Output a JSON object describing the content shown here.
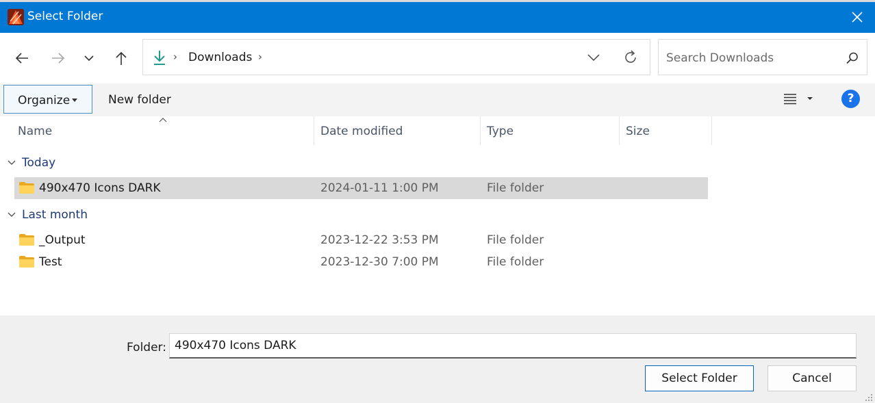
{
  "window": {
    "title": "Select Folder",
    "title_bar_color": "#0078d4",
    "app_icon": "affinity-publisher-icon",
    "close_icon": "close-icon"
  },
  "nav": {
    "back_icon": "arrow-left-icon",
    "forward_icon": "arrow-right-icon",
    "recent_icon": "chevron-down-icon",
    "up_icon": "arrow-up-icon"
  },
  "address": {
    "location_icon": "download-icon",
    "separator": "›",
    "segments": [
      "Downloads"
    ],
    "dropdown_icon": "chevron-down-icon",
    "refresh_icon": "refresh-icon"
  },
  "search": {
    "placeholder": "Search Downloads",
    "icon": "search-icon"
  },
  "toolbar": {
    "organize_label": "Organize",
    "new_folder_label": "New folder",
    "view_icon": "list-view-icon",
    "help_label": "?",
    "accent": "#1a73e8"
  },
  "columns": {
    "name": "Name",
    "date_modified": "Date modified",
    "type": "Type",
    "size": "Size"
  },
  "groups": [
    {
      "label": "Today",
      "items": [
        {
          "name": "490x470 Icons DARK",
          "date": "2024-01-11 1:00 PM",
          "type": "File folder",
          "selected": true
        }
      ]
    },
    {
      "label": "Last month",
      "items": [
        {
          "name": "_Output",
          "date": "2023-12-22 3:53 PM",
          "type": "File folder",
          "selected": false
        },
        {
          "name": "Test",
          "date": "2023-12-30 7:00 PM",
          "type": "File folder",
          "selected": false
        }
      ]
    }
  ],
  "footer": {
    "folder_label": "Folder:",
    "folder_value": "490x470 Icons DARK",
    "select_button": "Select Folder",
    "cancel_button": "Cancel"
  }
}
